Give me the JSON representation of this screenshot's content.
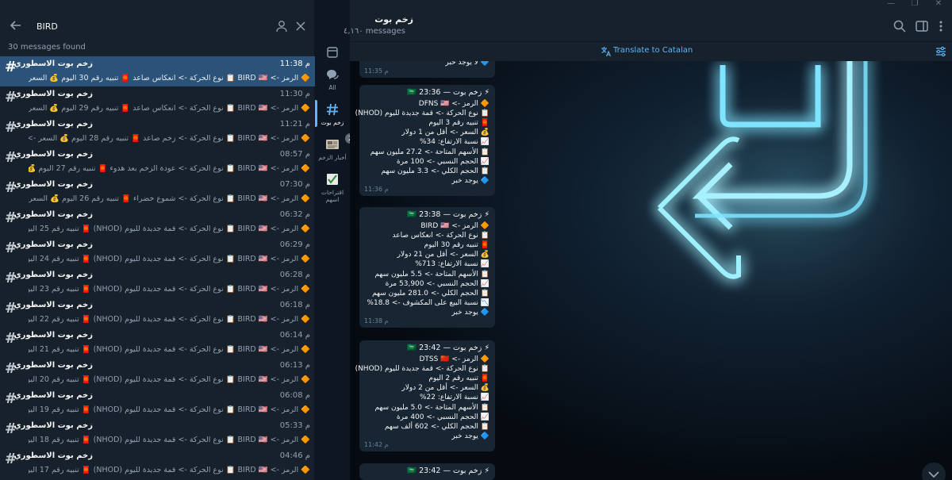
{
  "window": {
    "minimize": "—",
    "maximize": "❐",
    "close": "✕"
  },
  "search": {
    "query": "BIRD",
    "found_label": "30 messages found"
  },
  "results": [
    {
      "name": "زخم بوت الاسطوري",
      "time": "11:38 م",
      "preview": "🔶 الرمز -> BIRD 🇺🇸 📋 نوع الحركة -> انعكاس صاعد 🧧 تنبيه رقم 30 اليوم 💰 السعر -> أقل ..."
    },
    {
      "name": "زخم بوت الاسطوري",
      "time": "11:30 م",
      "preview": "🔶 الرمز -> BIRD 🇺🇸 📋 نوع الحركة -> انعكاس صاعد 🧧 تنبيه رقم 29 اليوم 💰 السعر -> أقل ..."
    },
    {
      "name": "زخم بوت الاسطوري",
      "time": "11:21 م",
      "preview": "🔶 الرمز -> BIRD 🇺🇸 📋 نوع الحركة -> زخم صاعد 🧧 تنبيه رقم 28 اليوم 💰 السعر -> أقل من..."
    },
    {
      "name": "زخم بوت الاسطوري",
      "time": "08:57 م",
      "preview": "🔶 الرمز -> BIRD 🇺🇸 📋 نوع الحركة -> عودة الزخم بعد هدوء 🧧 تنبيه رقم 27 اليوم 💰 السعر ..."
    },
    {
      "name": "زخم بوت الاسطوري",
      "time": "07:30 م",
      "preview": "🔶 الرمز -> BIRD 🇺🇸 📋 نوع الحركة -> شموع خضراء 🧧 تنبيه رقم 26 اليوم 💰 السعر -> أقل ..."
    },
    {
      "name": "زخم بوت الاسطوري",
      "time": "06:32 م",
      "preview": "🔶 الرمز -> BIRD 🇺🇸 📋 نوع الحركة -> قمة جديدة لليوم (NHOD) 🧧 تنبيه رقم 25 اليوم 💰 ..."
    },
    {
      "name": "زخم بوت الاسطوري",
      "time": "06:29 م",
      "preview": "🔶 الرمز -> BIRD 🇺🇸 📋 نوع الحركة -> قمة جديدة لليوم (NHOD) 🧧 تنبيه رقم 24 اليوم 💰 ..."
    },
    {
      "name": "زخم بوت الاسطوري",
      "time": "06:28 م",
      "preview": "🔶 الرمز -> BIRD 🇺🇸 📋 نوع الحركة -> قمة جديدة لليوم (NHOD) 🧧 تنبيه رقم 23 اليوم 💰 ..."
    },
    {
      "name": "زخم بوت الاسطوري",
      "time": "06:18 م",
      "preview": "🔶 الرمز -> BIRD 🇺🇸 📋 نوع الحركة -> قمة جديدة لليوم (NHOD) 🧧 تنبيه رقم 22 اليوم 💰 ..."
    },
    {
      "name": "زخم بوت الاسطوري",
      "time": "06:14 م",
      "preview": "🔶 الرمز -> BIRD 🇺🇸 📋 نوع الحركة -> قمة جديدة لليوم (NHOD) 🧧 تنبيه رقم 21 اليوم 💰 ..."
    },
    {
      "name": "زخم بوت الاسطوري",
      "time": "06:13 م",
      "preview": "🔶 الرمز -> BIRD 🇺🇸 📋 نوع الحركة -> قمة جديدة لليوم (NHOD) 🧧 تنبيه رقم 20 اليوم 💰 ..."
    },
    {
      "name": "زخم بوت الاسطوري",
      "time": "06:08 م",
      "preview": "🔶 الرمز -> BIRD 🇺🇸 📋 نوع الحركة -> قمة جديدة لليوم (NHOD) 🧧 تنبيه رقم 19 اليوم 💰 ..."
    },
    {
      "name": "زخم بوت الاسطوري",
      "time": "05:33 م",
      "preview": "🔶 الرمز -> BIRD 🇺🇸 📋 نوع الحركة -> قمة جديدة لليوم (NHOD) 🧧 تنبيه رقم 18 اليوم 💰 ..."
    },
    {
      "name": "زخم بوت الاسطوري",
      "time": "04:46 م",
      "preview": "🔶 الرمز -> BIRD 🇺🇸 📋 نوع الحركة -> قمة جديدة لليوم (NHOD) 🧧 تنبيه رقم 17 اليوم 💰 ..."
    }
  ],
  "folders": [
    {
      "label": "",
      "icon": "archive-icon"
    },
    {
      "label": "All",
      "icon": "chats-icon"
    },
    {
      "label": "زخم بوت",
      "icon": "hashtag-icon",
      "active": true
    },
    {
      "label": "أخبار الزخم",
      "icon": "news-icon",
      "badge": "2"
    },
    {
      "label": "اقتراحات اسهم",
      "icon": "suggestions-icon"
    }
  ],
  "chat": {
    "title": "زخم بوت",
    "count": "٤,١٦٠ messages",
    "translate_label": "Translate to Catalan"
  },
  "messages": [
    {
      "partial": true,
      "lines": [
        "🔷 لا يوجد خبر"
      ],
      "time": "11:35 م"
    },
    {
      "head": "⚡ زخم بوت — 23:36 🇸🇦",
      "lines": [
        "🔶 الرمز -> DFNS 🇺🇸",
        "📋 نوع الحركة -> قمة جديدة لليوم (NHOD)",
        "🧧 تنبيه رقم 3 اليوم",
        "💰 السعر -> أقل من 1 دولار",
        "📈 نسبة الارتفاع: 34%",
        "📋 الأسهم المتاحة -> 27.2 مليون سهم",
        "📈 الحجم النسبي -> 100 مرة",
        "📋 الحجم الكلي -> 3.3 مليون سهم",
        "🔷 يوجد خبر"
      ],
      "time": "11:36 م"
    },
    {
      "head": "⚡ زخم بوت — 23:38 🇸🇦",
      "lines": [
        "🔶 الرمز -> BIRD 🇺🇸",
        "📋 نوع الحركة -> انعكاس صاعد",
        "🧧 تنبيه رقم 30 اليوم",
        "💰 السعر -> أقل من 21 دولار",
        "📈 نسبة الارتفاع: 713%",
        "📋 الأسهم المتاحة -> 5.5 مليون سهم",
        "📈 الحجم النسبي -> 53,900 مرة",
        "📋 الحجم الكلي -> 281.0 مليون سهم",
        "📉 نسبة البيع على المكشوف -> 18.8%",
        "🔷 يوجد خبر"
      ],
      "time": "11:38 م"
    },
    {
      "head": "⚡ زخم بوت — 23:42 🇸🇦",
      "lines": [
        "🔶 الرمز -> DTSS 🇨🇳",
        "📋 نوع الحركة -> قمة جديدة لليوم (NHOD)",
        "🧧 تنبيه رقم 2 اليوم",
        "💰 السعر -> أقل من 2 دولار",
        "📈 نسبة الارتفاع: 22%",
        "📋 الأسهم المتاحة -> 5.0 مليون سهم",
        "📈 الحجم النسبي -> 400 مرة",
        "📋 الحجم الكلي -> 602 ألف سهم",
        "🔷 يوجد خبر"
      ],
      "time": "11:42 م"
    },
    {
      "head": "⚡ زخم بوت — 23:42 🇸🇦",
      "lines": [],
      "time": ""
    }
  ],
  "colors": {
    "accent": "#5eb5f7",
    "active_row": "#2b5278",
    "bubble": "#182533",
    "panel": "#17212b"
  }
}
